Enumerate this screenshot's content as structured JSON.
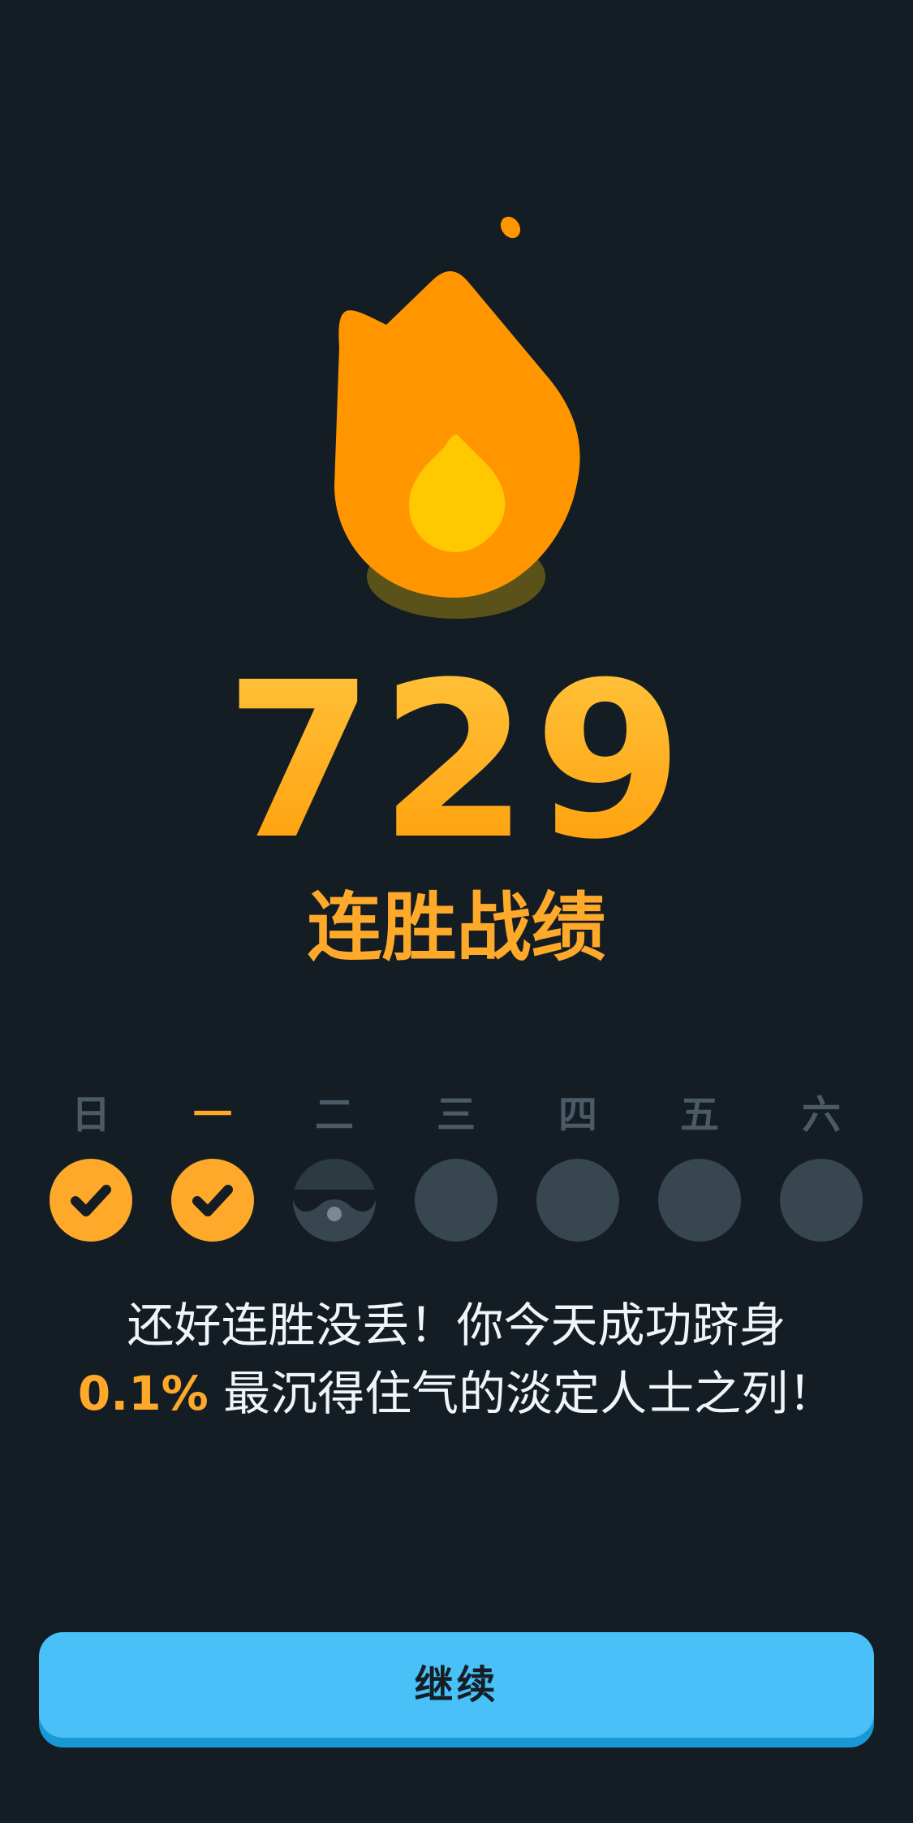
{
  "streak": {
    "count": "729",
    "label": "连胜战绩",
    "flame_icon": "flame-icon",
    "accent_color": "#ffa92b"
  },
  "week": {
    "days": [
      {
        "label": "日",
        "status": "done"
      },
      {
        "label": "一",
        "status": "done",
        "today": true
      },
      {
        "label": "二",
        "status": "freeze"
      },
      {
        "label": "三",
        "status": "empty"
      },
      {
        "label": "四",
        "status": "empty"
      },
      {
        "label": "五",
        "status": "empty"
      },
      {
        "label": "六",
        "status": "empty"
      }
    ]
  },
  "message": {
    "line1": "还好连胜没丢！你今天成功跻身",
    "percent": "0.1%",
    "line2": "最沉得住气的淡定人士之列！"
  },
  "continue_button": {
    "label": "继续",
    "color": "#49c0f8"
  }
}
